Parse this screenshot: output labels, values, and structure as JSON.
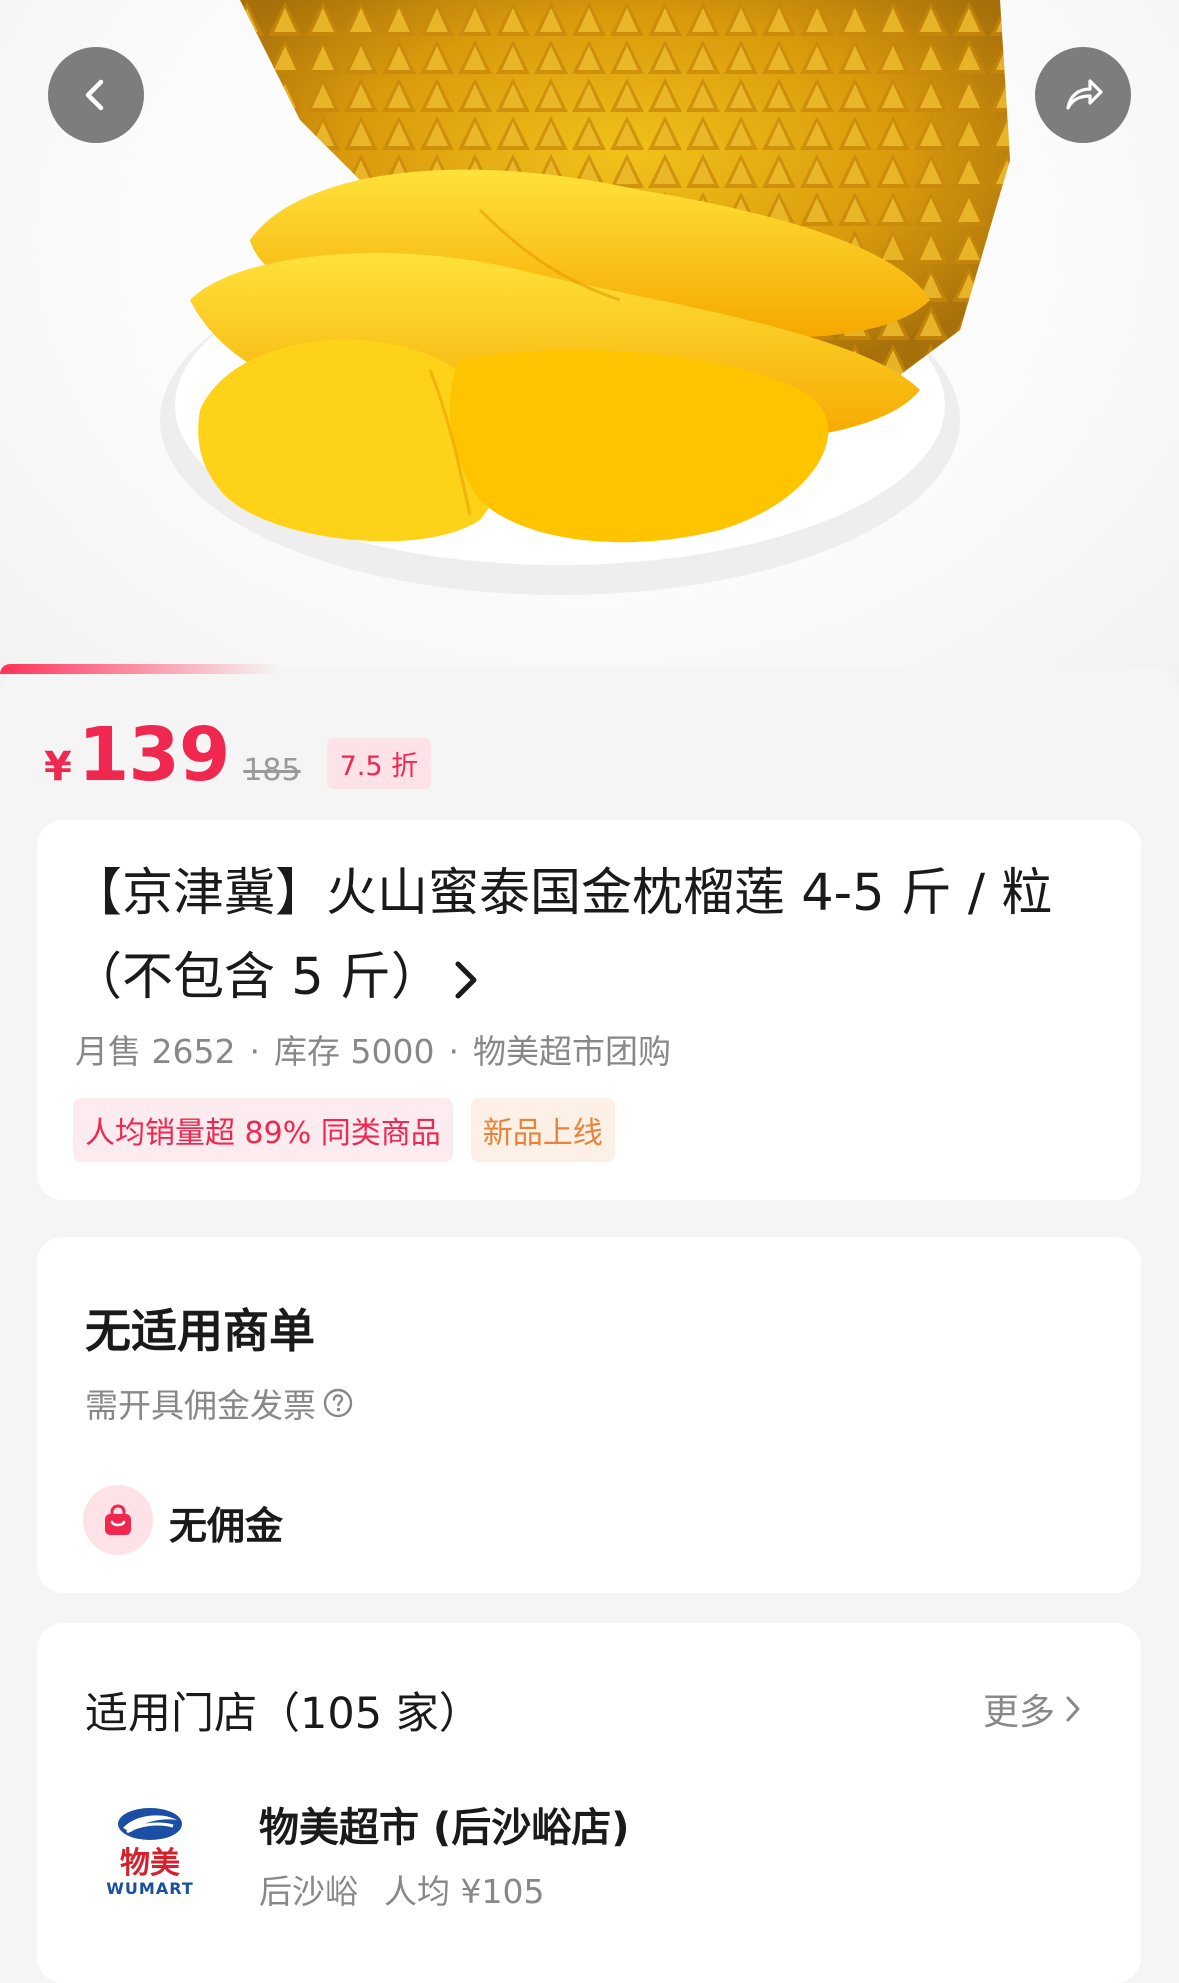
{
  "nav": {
    "back_icon": "chevron-left-icon",
    "share_icon": "share-icon"
  },
  "hero": {
    "image": "durian-photo"
  },
  "price": {
    "currency": "¥",
    "current": "139",
    "original": "185",
    "discount": "7.5 折",
    "accent_color": "#f0284f"
  },
  "product": {
    "title": "【京津冀】火山蜜泰国金枕榴莲 4-5 斤 / 粒（不包含 5 斤）",
    "monthly_sales": "月售 2652",
    "stock": "库存 5000",
    "seller": "物美超市团购",
    "separator": "·",
    "tags": [
      {
        "label": "人均销量超 89% 同类商品"
      },
      {
        "label": "新品上线"
      }
    ]
  },
  "commission": {
    "title": "无适用商单",
    "subtitle": "需开具佣金发票",
    "help_icon": "question-circle-icon",
    "badge_icon": "shopping-bag-icon",
    "label": "无佣金"
  },
  "stores": {
    "title": "适用门店（105 家）",
    "more_label": "更多",
    "store": {
      "logo_cn": "物美",
      "logo_en": "WUMART",
      "name": "物美超市 (后沙峪店)",
      "area": "后沙峪",
      "avg_price": "人均 ¥105"
    }
  }
}
